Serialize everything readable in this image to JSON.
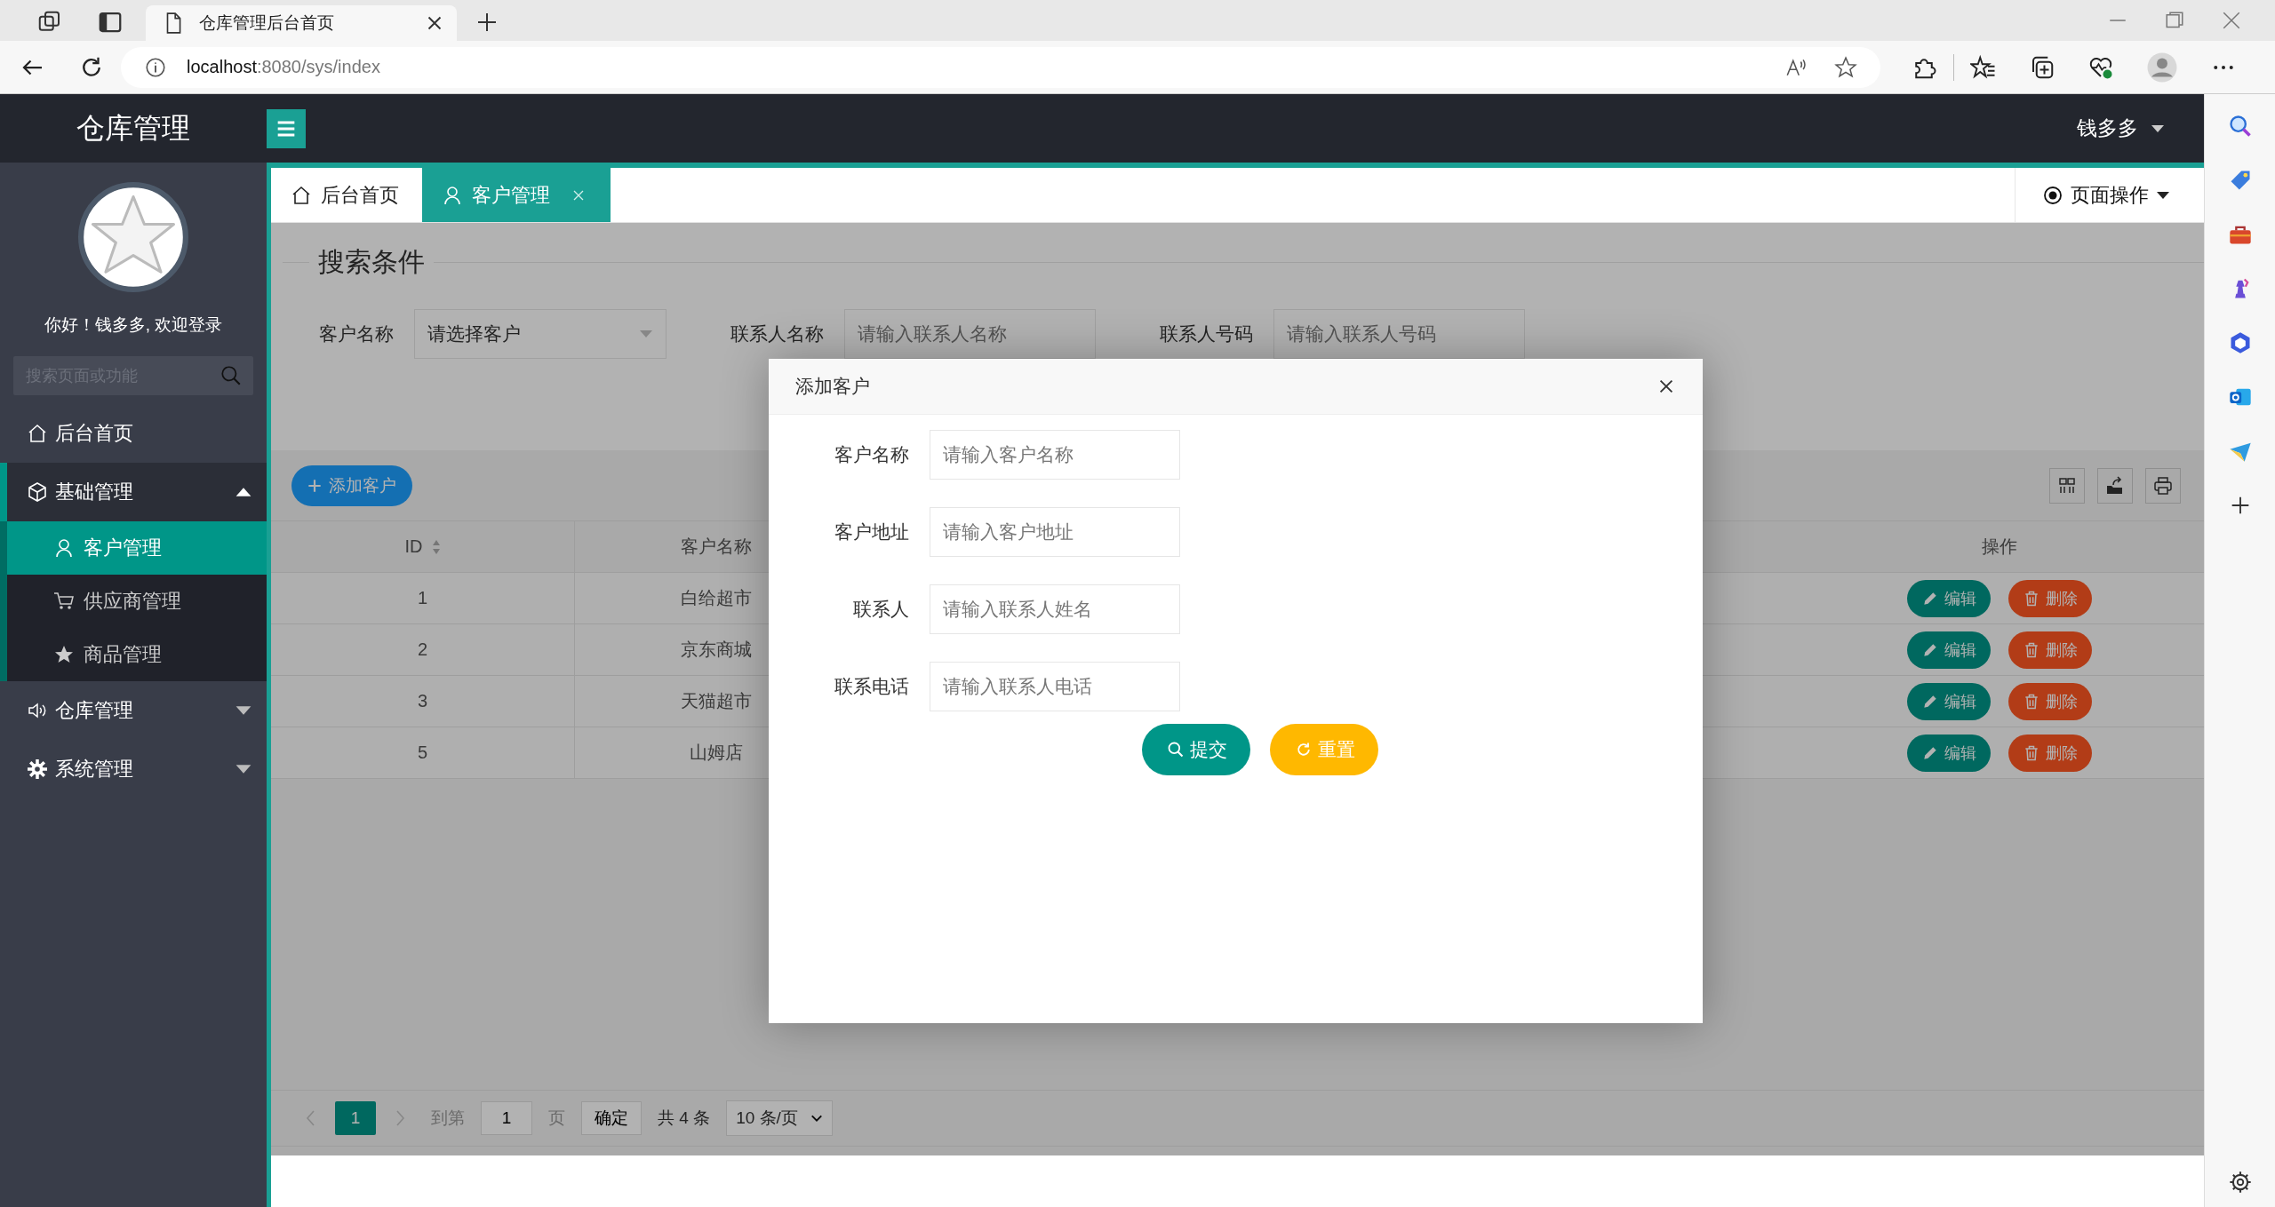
{
  "browser": {
    "tab_title": "仓库管理后台首页",
    "url_host": "localhost",
    "url_path": ":8080/sys/index"
  },
  "app": {
    "logo": "仓库管理",
    "user": "钱多多"
  },
  "sidebar": {
    "greeting": "你好！钱多多, 欢迎登录",
    "search_placeholder": "搜索页面或功能",
    "items": [
      {
        "label": "后台首页",
        "kind": "link",
        "selected": false
      },
      {
        "label": "基础管理",
        "kind": "group",
        "expanded": true,
        "selected": false,
        "children": [
          {
            "label": "客户管理",
            "selected": true
          },
          {
            "label": "供应商管理",
            "selected": false
          },
          {
            "label": "商品管理",
            "selected": false
          }
        ]
      },
      {
        "label": "仓库管理",
        "kind": "group",
        "expanded": false,
        "selected": false
      },
      {
        "label": "系统管理",
        "kind": "group",
        "expanded": false,
        "selected": false
      }
    ]
  },
  "tabs": [
    {
      "label": "后台首页",
      "selected": false,
      "closable": false
    },
    {
      "label": "客户管理",
      "selected": true,
      "closable": true
    }
  ],
  "page_ops": "页面操作",
  "search": {
    "title": "搜索条件",
    "fields": [
      {
        "label": "客户名称",
        "kind": "select",
        "value": "请选择客户"
      },
      {
        "label": "联系人名称",
        "kind": "input",
        "placeholder": "请输入联系人名称"
      },
      {
        "label": "联系人号码",
        "kind": "input",
        "placeholder": "请输入联系人号码"
      }
    ]
  },
  "toolbar": {
    "add_button": "添加客户"
  },
  "table": {
    "columns": [
      {
        "label": "ID",
        "sortable": true
      },
      {
        "label": "客户名称",
        "sortable": false
      },
      {
        "label": "操作",
        "sortable": false
      }
    ],
    "rows": [
      {
        "id": "1",
        "name": "白给超市",
        "actions": [
          "编辑",
          "删除"
        ]
      },
      {
        "id": "2",
        "name": "京东商城",
        "actions": [
          "编辑",
          "删除"
        ]
      },
      {
        "id": "3",
        "name": "天猫超市",
        "actions": [
          "编辑",
          "删除"
        ]
      },
      {
        "id": "5",
        "name": "山姆店",
        "actions": [
          "编辑",
          "删除"
        ]
      }
    ]
  },
  "pagination": {
    "pages": [
      {
        "label": "1",
        "selected": true
      }
    ],
    "goto_label": "到第",
    "goto_value": "1",
    "page_unit": "页",
    "confirm": "确定",
    "total": "共 4 条",
    "page_size": "10 条/页"
  },
  "modal": {
    "title": "添加客户",
    "fields": [
      {
        "label": "客户名称",
        "placeholder": "请输入客户名称"
      },
      {
        "label": "客户地址",
        "placeholder": "请输入客户地址"
      },
      {
        "label": "联系人",
        "placeholder": "请输入联系人姓名"
      },
      {
        "label": "联系电话",
        "placeholder": "请输入联系人电话"
      }
    ],
    "buttons": [
      {
        "label": "提交",
        "kind": "submit"
      },
      {
        "label": "重置",
        "kind": "reset"
      }
    ]
  }
}
